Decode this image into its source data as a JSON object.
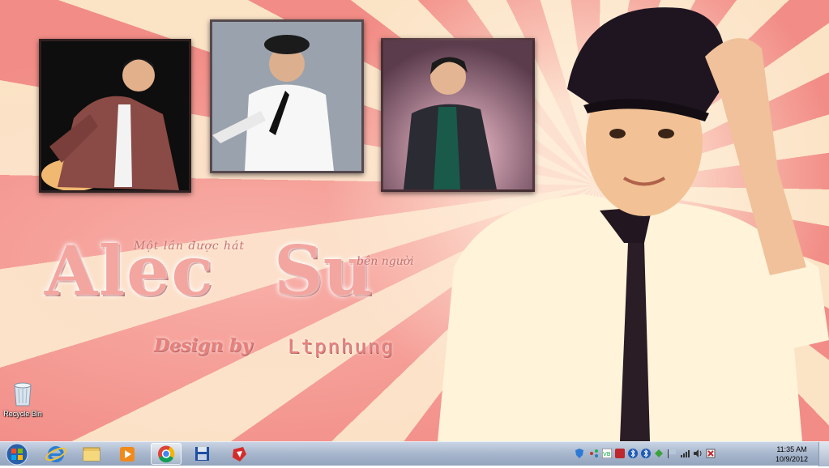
{
  "wallpaper": {
    "title_first": "Alec",
    "title_last": "Su",
    "subtitle": "Một lần được hát",
    "subtitle_end": "bên người",
    "design_label": "Design by",
    "author": "Ltpnhung",
    "colors": {
      "stripe_pink": "#f28c86",
      "stripe_cream": "#fbe3c6",
      "title": "#f3a6a0"
    }
  },
  "desktop_icons": [
    {
      "label": "Recycle Bin",
      "icon": "recycle-bin-icon"
    }
  ],
  "taskbar": {
    "start_icon": "windows-start-icon",
    "pinned": [
      {
        "icon": "internet-explorer-icon",
        "active": false
      },
      {
        "icon": "file-explorer-icon",
        "active": false
      },
      {
        "icon": "media-player-icon",
        "active": false
      },
      {
        "icon": "chrome-icon",
        "active": true
      },
      {
        "icon": "floppy-save-icon",
        "active": false
      },
      {
        "icon": "red-logo-app-icon",
        "active": false
      }
    ],
    "tray_icons": [
      "shield-icon",
      "network-share-icon",
      "vb-icon",
      "red-app-icon",
      "bluetooth-icon",
      "bluetooth-icon",
      "green-app-icon",
      "flag-icon",
      "network-icon",
      "volume-icon",
      "action-center-icon"
    ],
    "clock": {
      "time": "11:35 AM",
      "date": "10/9/2012"
    }
  }
}
